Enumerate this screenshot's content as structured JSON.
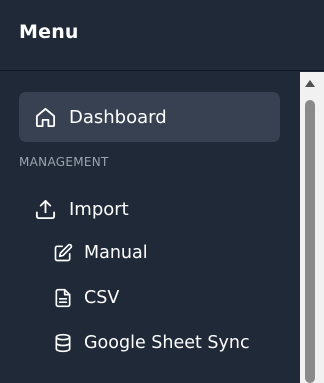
{
  "menu": {
    "title": "Menu"
  },
  "nav": {
    "dashboard": {
      "label": "Dashboard",
      "icon": "home-icon",
      "active": true
    },
    "section_label": "MANAGEMENT",
    "import": {
      "label": "Import",
      "icon": "upload-icon",
      "children": [
        {
          "label": "Manual",
          "icon": "edit-icon"
        },
        {
          "label": "CSV",
          "icon": "file-text-icon"
        },
        {
          "label": "Google Sheet Sync",
          "icon": "database-icon"
        }
      ]
    }
  },
  "colors": {
    "background": "#1f2937",
    "active_item": "#374151",
    "section_label": "#9ca3af",
    "text": "#ffffff"
  }
}
